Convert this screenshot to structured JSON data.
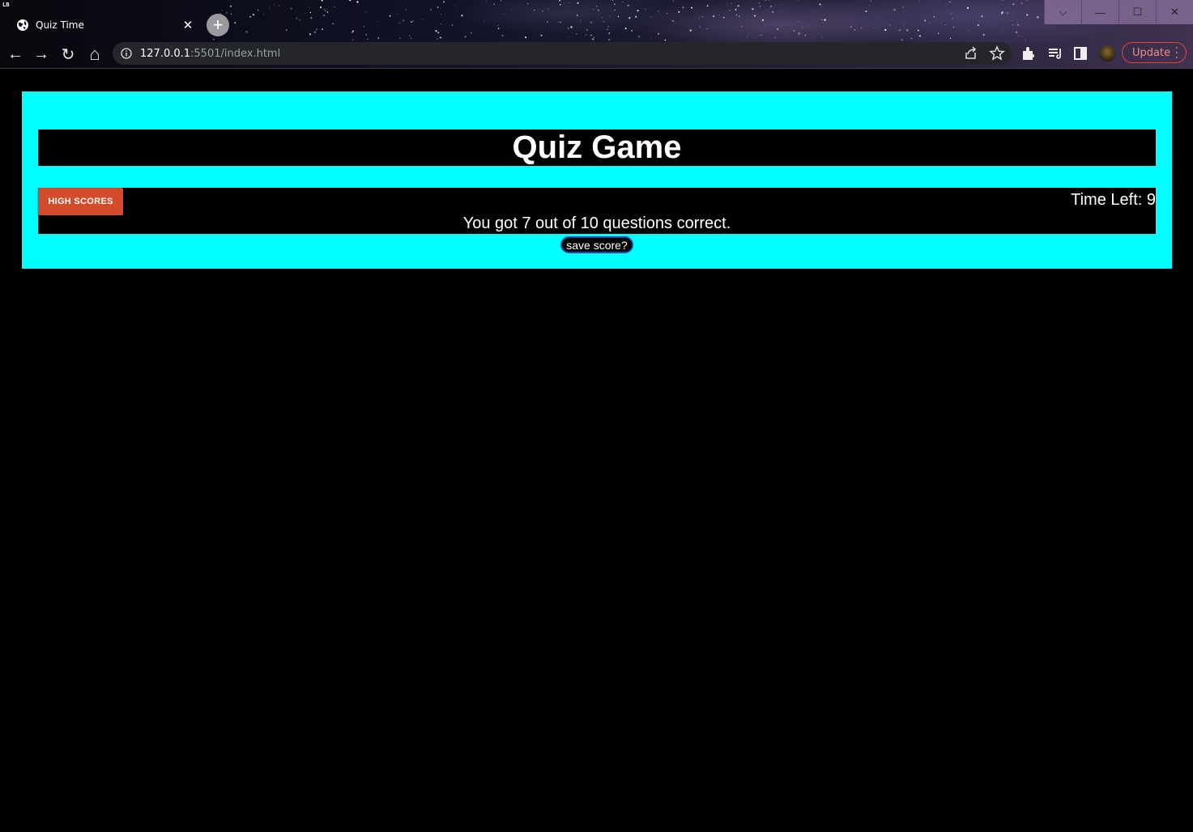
{
  "browser": {
    "app_logo": "LB",
    "tab": {
      "title": "Quiz Time",
      "close_glyph": "✕"
    },
    "new_tab_glyph": "+",
    "window_controls": {
      "minimize": "—",
      "maximize": "☐",
      "close": "✕",
      "menu": "⌵"
    },
    "nav": {
      "back": "←",
      "forward": "→",
      "reload": "↻",
      "home": "⌂"
    },
    "address": {
      "host": "127.0.0.1",
      "path": ":5501/index.html"
    },
    "update_label": "Update",
    "icons": [
      "info-icon",
      "share-icon",
      "star-icon",
      "extensions-icon",
      "media-icon",
      "side-panel-icon",
      "profile-avatar",
      "menu-dots-icon"
    ]
  },
  "quiz": {
    "title": "Quiz Game",
    "high_scores_label": "HIGH SCORES",
    "time_left": "Time Left: 9",
    "result": "You got 7 out of 10 questions correct.",
    "save_label": "save score?"
  },
  "colors": {
    "page_background": "#000000",
    "panel": "#00ffff",
    "bar": "#000000",
    "high_scores_button": "#d24b2a",
    "update_accent": "#e0463a",
    "save_border": "#1a4ea8"
  }
}
